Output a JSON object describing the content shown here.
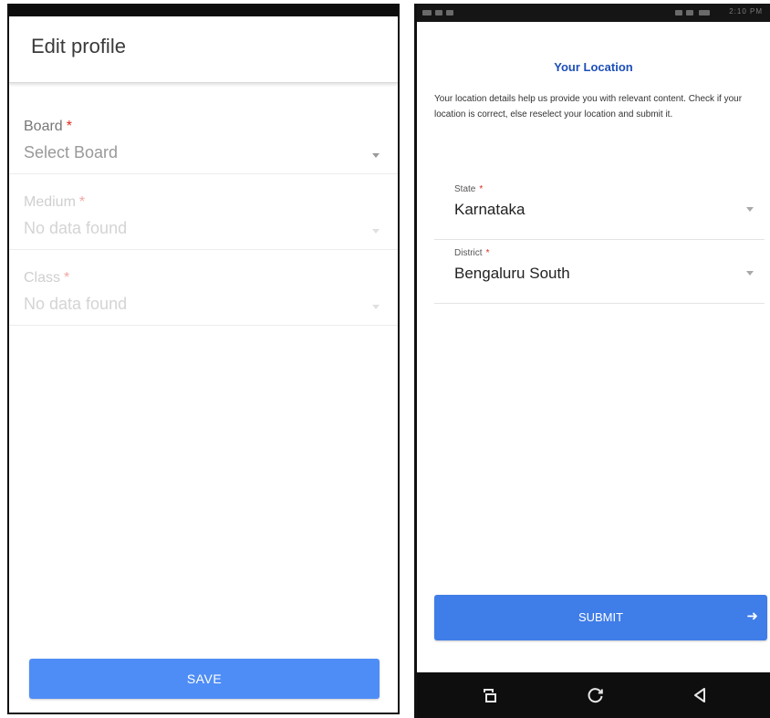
{
  "left_screen": {
    "title": "Edit profile",
    "fields": [
      {
        "label": "Board",
        "required_mark": "*",
        "value": "Select Board",
        "disabled": false
      },
      {
        "label": "Medium",
        "required_mark": "*",
        "value": "No data found",
        "disabled": true
      },
      {
        "label": "Class",
        "required_mark": "*",
        "value": "No data found",
        "disabled": true
      }
    ],
    "save_label": "SAVE"
  },
  "right_screen": {
    "status_time": "2:10 PM",
    "heading": "Your Location",
    "description": "Your location details help us provide you with relevant content. Check if your location is correct, else reselect your location and submit it.",
    "fields": [
      {
        "label": "State",
        "required_mark": "*",
        "value": "Karnataka"
      },
      {
        "label": "District",
        "required_mark": "*",
        "value": "Bengaluru South"
      }
    ],
    "submit_label": "SUBMIT",
    "nav_icons": [
      "recent-apps-icon",
      "home-icon",
      "back-icon"
    ]
  },
  "colors": {
    "primary_button": "#4f8df6",
    "heading_blue": "#1d4fb8",
    "required_red": "#e0281f"
  }
}
